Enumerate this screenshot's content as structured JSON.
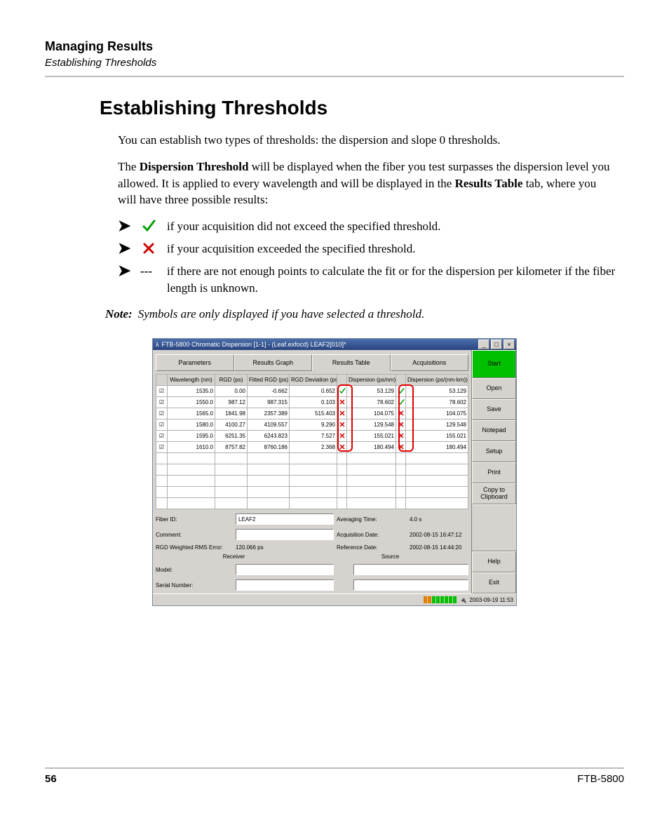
{
  "header": {
    "section": "Managing Results",
    "subsection": "Establishing Thresholds"
  },
  "title": "Establishing Thresholds",
  "p1": "You can establish two types of thresholds: the dispersion and slope 0 thresholds.",
  "p2a": "The ",
  "p2b": "Dispersion Threshold",
  "p2c": " will be displayed when the fiber you test surpasses the dispersion level you allowed. It is applied to every wavelength and will be displayed in the ",
  "p2d": "Results Table",
  "p2e": " tab, where you will have three possible results:",
  "bullets": [
    "if your acquisition did not exceed the specified threshold.",
    "if your acquisition exceeded the specified threshold.",
    "if there are not enough points to calculate the fit or for the dispersion per kilometer if the fiber length is unknown."
  ],
  "dash": "---",
  "note_label": "Note:",
  "note_text": "Symbols are only displayed if you have selected a threshold.",
  "app": {
    "title": "FTB-5800 Chromatic Dispersion [1-1] - (Leaf.exfocd) LEAF2[010]*",
    "tabs": [
      "Parameters",
      "Results Graph",
      "Results Table",
      "Acquisitions"
    ],
    "headers": [
      "",
      "Wavelength (nm)",
      "RGD (ps)",
      "Fitted RGD (ps)",
      "RGD Deviation (ps)",
      "",
      "Dispersion (ps/nm)",
      "",
      "Dispersion (ps/(nm·km))"
    ],
    "rows": [
      {
        "wl": "1535.0",
        "rgd": "0.00",
        "frgd": "-0.662",
        "dev": "0.652",
        "s1": "ok",
        "d": "53.129",
        "s2": "ok",
        "dk": "53.129"
      },
      {
        "wl": "1550.0",
        "rgd": "987.12",
        "frgd": "987.315",
        "dev": "0.103",
        "s1": "x",
        "d": "78.602",
        "s2": "ok",
        "dk": "78.602"
      },
      {
        "wl": "1565.0",
        "rgd": "1841.98",
        "frgd": "2357.389",
        "dev": "515.403",
        "s1": "x",
        "d": "104.075",
        "s2": "x",
        "dk": "104.075"
      },
      {
        "wl": "1580.0",
        "rgd": "4100.27",
        "frgd": "4109.557",
        "dev": "9.290",
        "s1": "x",
        "d": "129.548",
        "s2": "x",
        "dk": "129.548"
      },
      {
        "wl": "1595.0",
        "rgd": "6251.35",
        "frgd": "6243.823",
        "dev": "7.527",
        "s1": "x",
        "d": "155.021",
        "s2": "x",
        "dk": "155.021"
      },
      {
        "wl": "1610.0",
        "rgd": "8757.82",
        "frgd": "8760.186",
        "dev": "2.368",
        "s1": "x",
        "d": "180.494",
        "s2": "x",
        "dk": "180.494"
      }
    ],
    "labels": {
      "fiber_id": "Fiber ID:",
      "comment": "Comment:",
      "rms": "RGD Weighted RMS Error:",
      "avg": "Averaging Time:",
      "acq": "Acquisition Date:",
      "ref": "Reference Date:",
      "receiver": "Receiver",
      "source": "Source",
      "model": "Model:",
      "serial": "Serial Number:"
    },
    "values": {
      "fiber_id": "LEAF2",
      "comment": "",
      "rms": "120.066 ps",
      "avg": "4.0 s",
      "acq": "2002-08-15 16:47:12",
      "ref": "2002-08-15 14:44:20"
    },
    "side": [
      "Start",
      "Open",
      "Save",
      "Notepad",
      "Setup",
      "Print",
      "Copy to Clipboard",
      "Help",
      "Exit"
    ],
    "status_time": "2003-09-19 11:53"
  },
  "footer": {
    "page": "56",
    "product": "FTB-5800"
  }
}
